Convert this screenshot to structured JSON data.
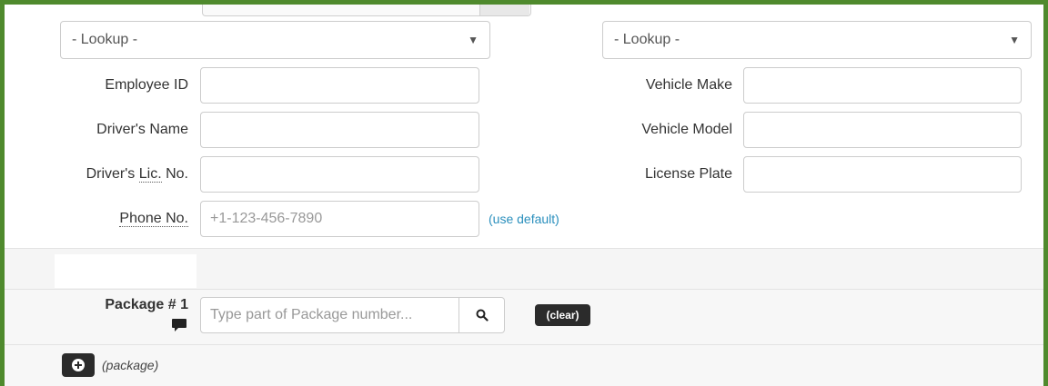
{
  "driver": {
    "lookup_placeholder": "- Lookup -",
    "fields": [
      {
        "label": "Employee ID",
        "value": ""
      },
      {
        "label": "Driver's Name",
        "value": ""
      },
      {
        "label_prefix": "Driver's ",
        "label_abbr": "Lic.",
        "label_suffix": " No.",
        "value": ""
      },
      {
        "label": "Phone No.",
        "placeholder": "+1-123-456-7890"
      }
    ],
    "use_default_link": "(use default)"
  },
  "vehicle": {
    "lookup_placeholder": "- Lookup -",
    "fields": [
      {
        "label": "Vehicle Make",
        "value": ""
      },
      {
        "label": "Vehicle Model",
        "value": ""
      },
      {
        "label": "License Plate",
        "value": ""
      }
    ]
  },
  "package": {
    "label": "Package # 1",
    "search_placeholder": "Type part of Package number...",
    "clear_label": "(clear)",
    "add_label": "(package)"
  },
  "icons": {
    "caret": "caret-down-icon",
    "comment": "comment-icon",
    "search": "search-icon",
    "add": "plus-circle-icon"
  },
  "colors": {
    "frame_border": "#4f8a2d",
    "link": "#2a8fbd",
    "dark_button": "#2b2b2b"
  }
}
